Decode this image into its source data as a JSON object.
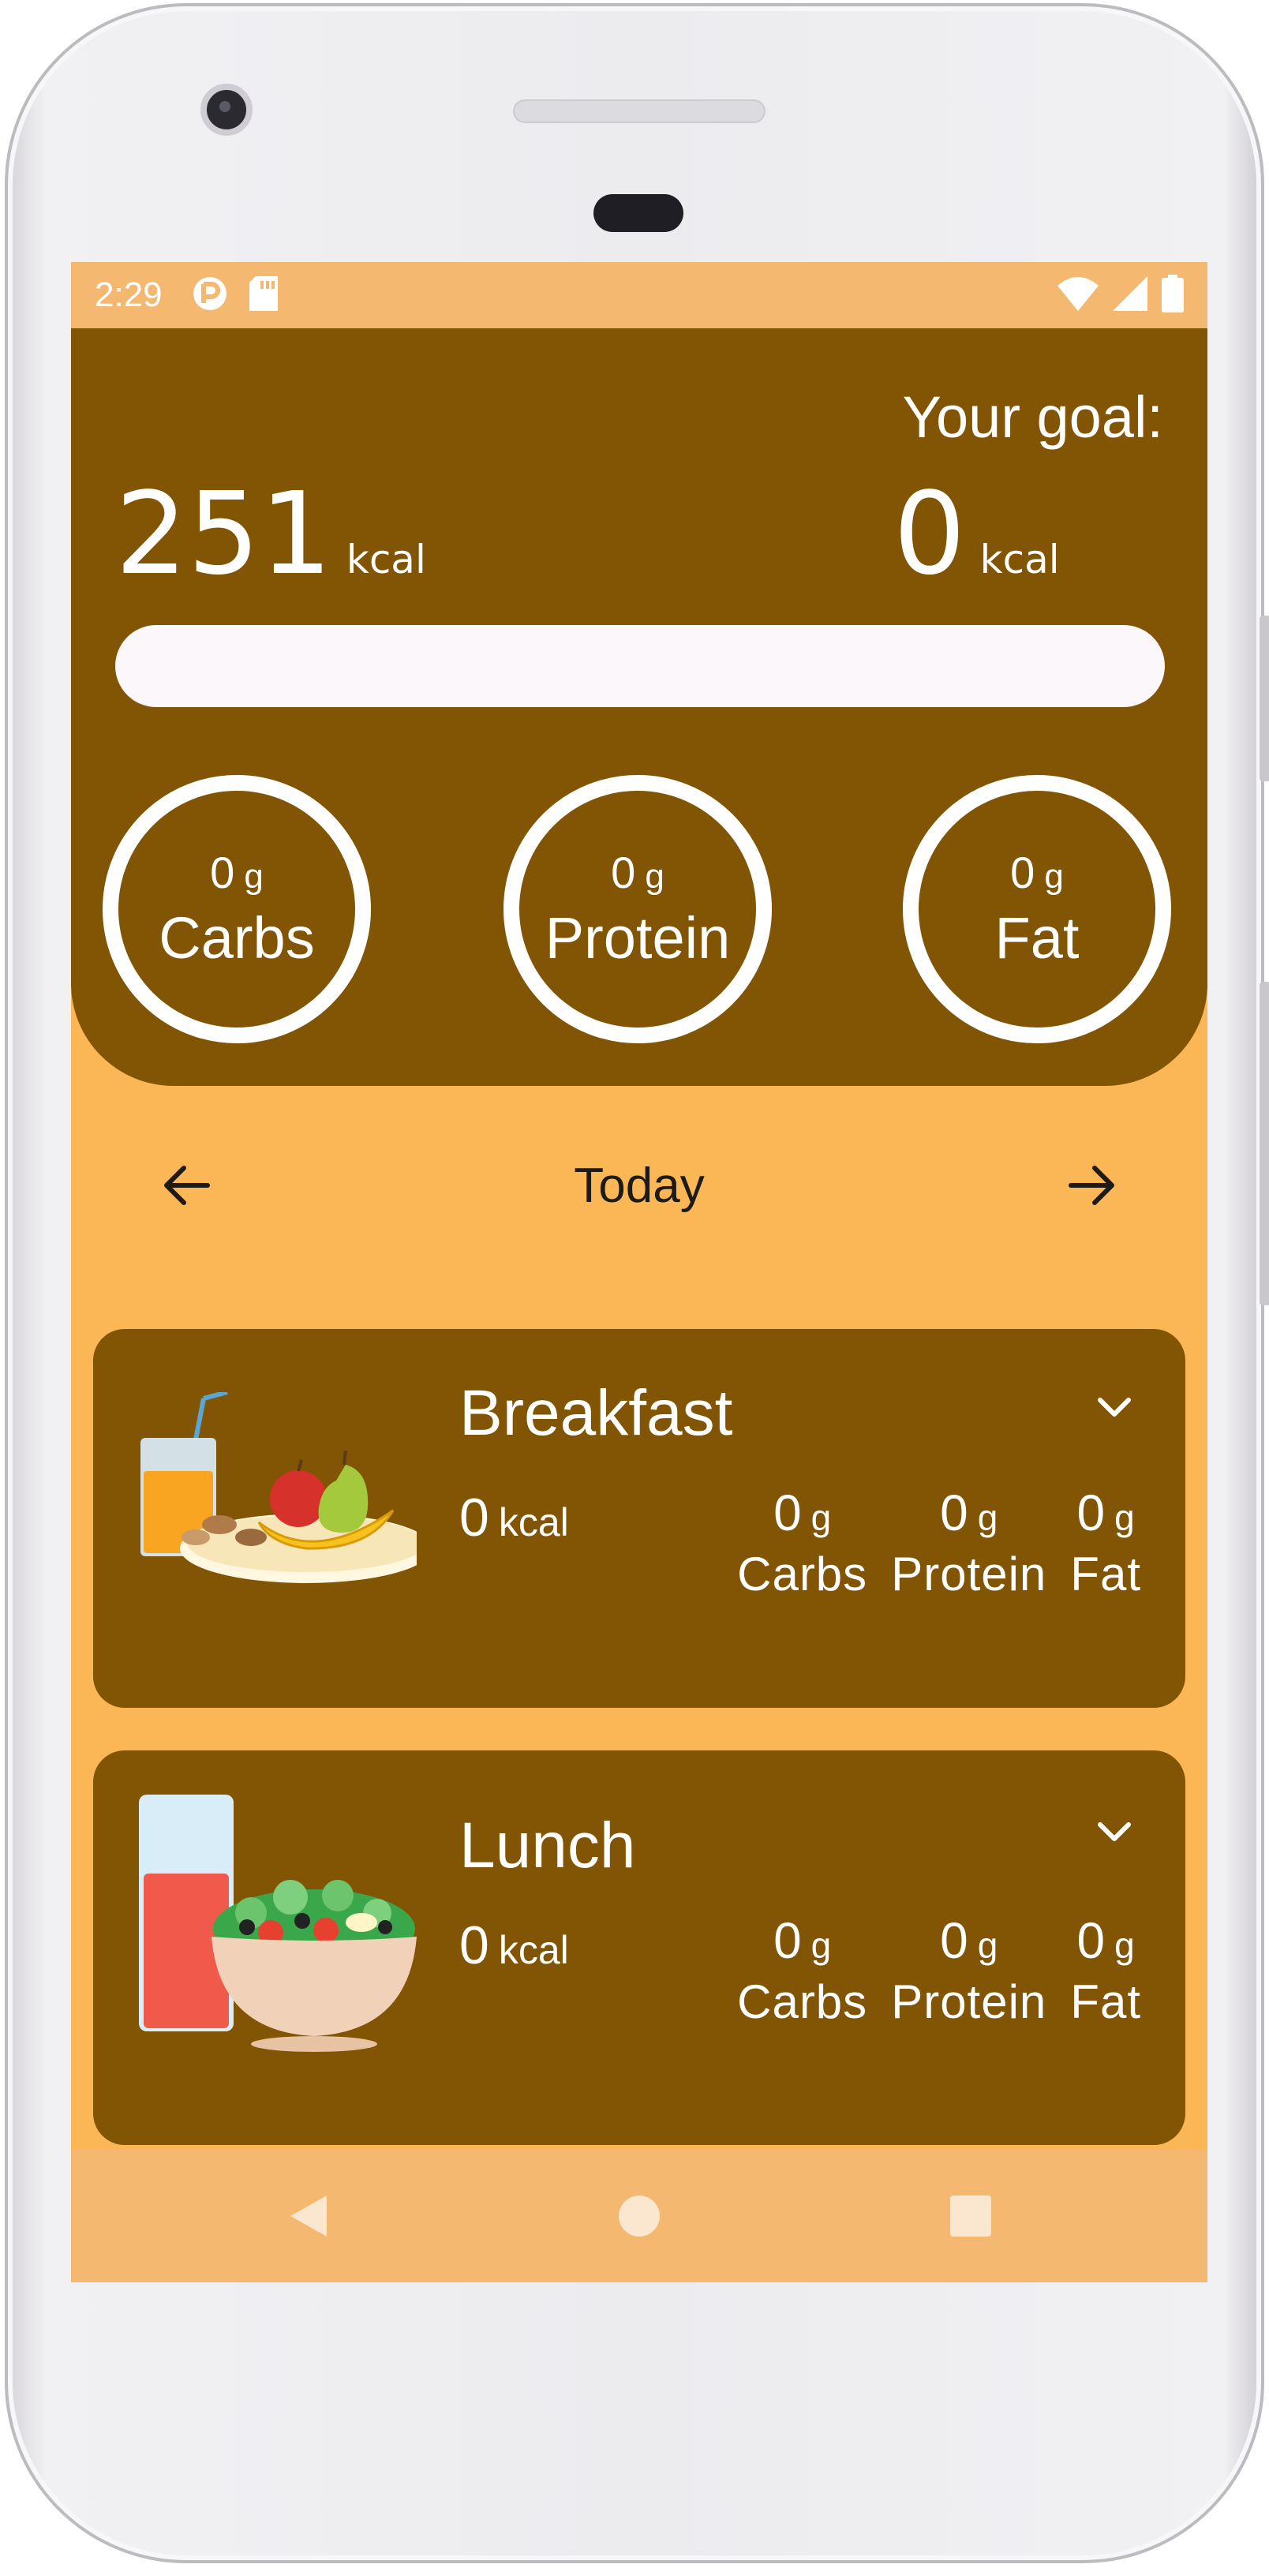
{
  "status_bar": {
    "time": "2:29"
  },
  "summary": {
    "goal_label": "Your goal:",
    "consumed": {
      "value": "251",
      "unit": "kcal"
    },
    "goal": {
      "value": "0",
      "unit": "kcal"
    },
    "progress_fraction": 0,
    "macros": [
      {
        "value": "0",
        "unit": "g",
        "name": "Carbs"
      },
      {
        "value": "0",
        "unit": "g",
        "name": "Protein"
      },
      {
        "value": "0",
        "unit": "g",
        "name": "Fat"
      }
    ]
  },
  "date_nav": {
    "label": "Today"
  },
  "meals": [
    {
      "title": "Breakfast",
      "kcal": {
        "value": "0",
        "unit": "kcal"
      },
      "macros": [
        {
          "value": "0",
          "unit": "g",
          "name": "Carbs"
        },
        {
          "value": "0",
          "unit": "g",
          "name": "Protein"
        },
        {
          "value": "0",
          "unit": "g",
          "name": "Fat"
        }
      ],
      "icon": "breakfast-illustration"
    },
    {
      "title": "Lunch",
      "kcal": {
        "value": "0",
        "unit": "kcal"
      },
      "macros": [
        {
          "value": "0",
          "unit": "g",
          "name": "Carbs"
        },
        {
          "value": "0",
          "unit": "g",
          "name": "Protein"
        },
        {
          "value": "0",
          "unit": "g",
          "name": "Fat"
        }
      ],
      "icon": "lunch-illustration"
    }
  ],
  "colors": {
    "header_brown": "#815503",
    "background_orange": "#fbb655",
    "bar_orange": "#f5b870",
    "progress_track": "#fbf7fa"
  }
}
